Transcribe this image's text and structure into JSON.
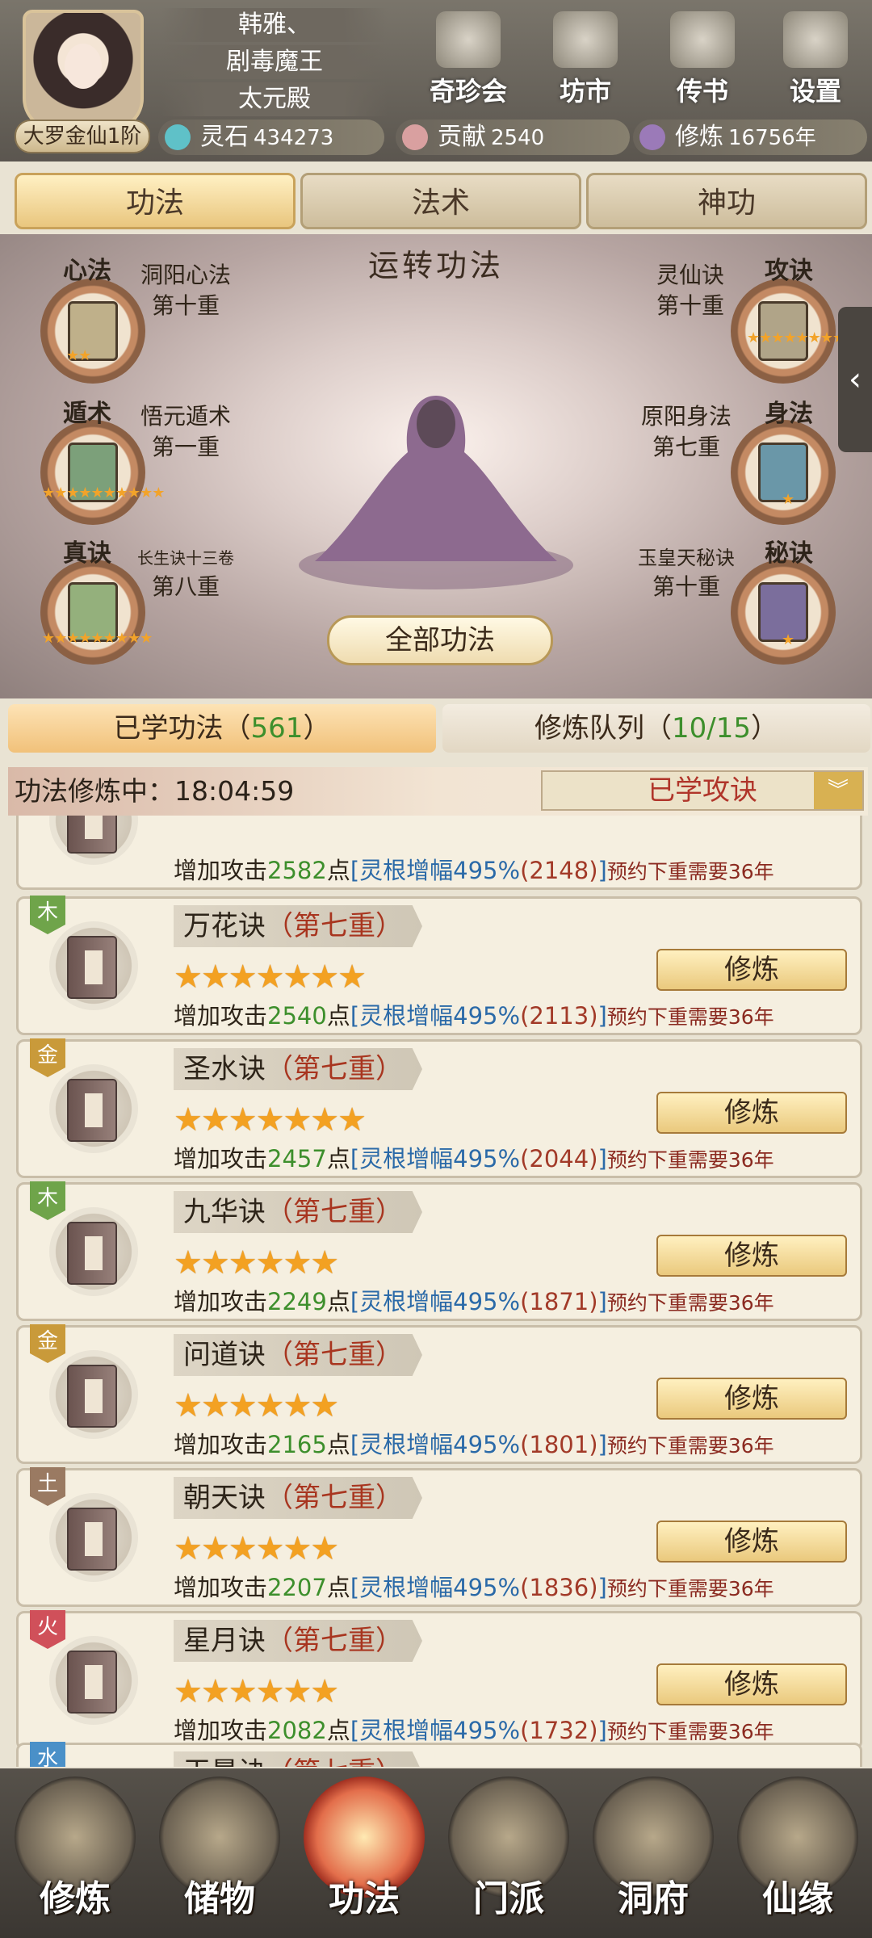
{
  "header": {
    "rank": "大罗金仙1阶",
    "names": [
      "韩雅、",
      "剧毒魔王",
      "太元殿"
    ],
    "resources": [
      {
        "label": "灵石",
        "value": "434273",
        "color": "#5fc1c8"
      },
      {
        "label": "贡献",
        "value": "2540",
        "color": "#d9a0a0"
      },
      {
        "label": "修炼",
        "value": "16756年",
        "color": "#9b7ab8"
      }
    ],
    "buttons": [
      {
        "label": "奇珍会",
        "icon": "pavilion-icon"
      },
      {
        "label": "坊市",
        "icon": "market-icon"
      },
      {
        "label": "传书",
        "icon": "scroll-icon"
      },
      {
        "label": "设置",
        "icon": "gear-icon"
      }
    ]
  },
  "tabs": [
    "功法",
    "法术",
    "神功"
  ],
  "scene": {
    "title": "运转功法",
    "all_button": "全部功法",
    "left_slots": [
      {
        "tag": "心法",
        "name": "洞阳心法",
        "level": "第十重",
        "stars": "★★"
      },
      {
        "tag": "遁术",
        "name": "悟元遁术",
        "level": "第一重",
        "stars": "★★★★★★★★★★"
      },
      {
        "tag": "真诀",
        "name": "长生诀十三卷",
        "level": "第八重",
        "stars": "★★★★★★★★★"
      }
    ],
    "right_slots": [
      {
        "tag": "攻诀",
        "name": "灵仙诀",
        "level": "第十重",
        "stars": "★★★★★★★★★"
      },
      {
        "tag": "身法",
        "name": "原阳身法",
        "level": "第七重",
        "stars": "★"
      },
      {
        "tag": "秘诀",
        "name": "玉皇天秘诀",
        "level": "第十重",
        "stars": "★"
      }
    ]
  },
  "list_tabs": {
    "learned_label": "已学功法（",
    "learned_count": "561",
    "learned_close": "）",
    "queue_label": "修炼队列（",
    "queue_count": "10/15",
    "queue_close": "）"
  },
  "status": {
    "text": "功法修炼中：18:04:59",
    "filter": "已学攻诀"
  },
  "partial_top": {
    "desc_prefix": "增加攻击",
    "value": "2582",
    "unit": "点",
    "boost": "[灵根增幅495%",
    "base": "(2148)",
    "close": "]",
    "note": "预约下重需要36年"
  },
  "items": [
    {
      "element": "木",
      "elem_color": "#6fa44a",
      "name": "万花诀",
      "level": "（第七重）",
      "stars": "★★★★★★★",
      "value": "2540",
      "base": "(2113)"
    },
    {
      "element": "金",
      "elem_color": "#c99a3a",
      "name": "圣水诀",
      "level": "（第七重）",
      "stars": "★★★★★★★",
      "value": "2457",
      "base": "(2044)"
    },
    {
      "element": "木",
      "elem_color": "#6fa44a",
      "name": "九华诀",
      "level": "（第七重）",
      "stars": "★★★★★★",
      "value": "2249",
      "base": "(1871)"
    },
    {
      "element": "金",
      "elem_color": "#c99a3a",
      "name": "问道诀",
      "level": "（第七重）",
      "stars": "★★★★★★",
      "value": "2165",
      "base": "(1801)"
    },
    {
      "element": "土",
      "elem_color": "#9a7a62",
      "name": "朝天诀",
      "level": "（第七重）",
      "stars": "★★★★★★",
      "value": "2207",
      "base": "(1836)"
    },
    {
      "element": "火",
      "elem_color": "#d0505a",
      "name": "星月诀",
      "level": "（第七重）",
      "stars": "★★★★★★",
      "value": "2082",
      "base": "(1732)"
    }
  ],
  "item_common": {
    "desc_prefix": "增加攻击",
    "unit": "点",
    "boost": "[灵根增幅495%",
    "close": "]",
    "note": "预约下重需要36年",
    "train": "修炼"
  },
  "partial_bottom": {
    "element": "水",
    "elem_color": "#4a90c8",
    "name": "玉景诀",
    "level": "（第七重）"
  },
  "nav": [
    {
      "label": "修炼",
      "icon": "cultivate-icon"
    },
    {
      "label": "储物",
      "icon": "storage-bag-icon"
    },
    {
      "label": "功法",
      "icon": "scroll-book-icon"
    },
    {
      "label": "门派",
      "icon": "sect-gate-icon"
    },
    {
      "label": "洞府",
      "icon": "cave-mountain-icon"
    },
    {
      "label": "仙缘",
      "icon": "fate-swirl-icon"
    }
  ],
  "side_tab": "‹"
}
